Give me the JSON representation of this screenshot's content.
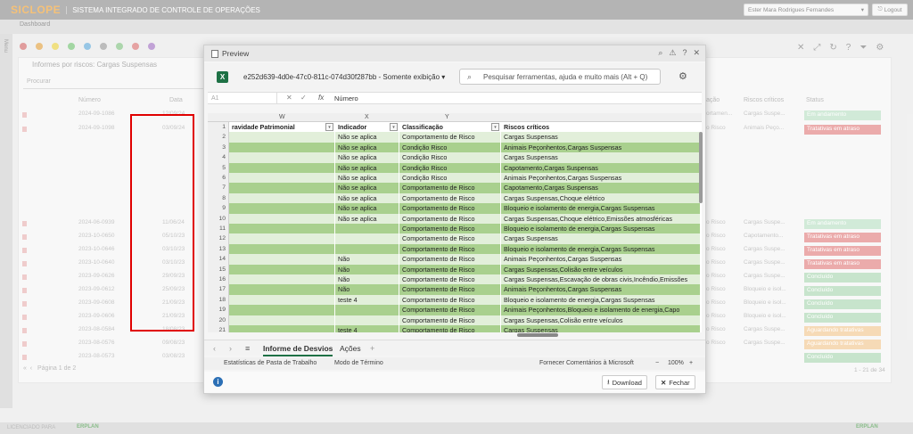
{
  "app": {
    "logo": "SICLOPE",
    "system_title": "SISTEMA INTEGRADO DE CONTROLE DE OPERAÇÕES",
    "user_name": "Ester Mara Rodrigues Fernandes",
    "logout_label": "Logout",
    "side_menu_label": "Menu",
    "dashboard_tab": "Dashboard"
  },
  "background": {
    "title": "Informes por riscos: Cargas Suspensas",
    "search_placeholder": "Procurar",
    "columns": {
      "numero": "Número",
      "data": "Data",
      "classificacao": "ação",
      "riscos": "Riscos críticos",
      "status": "Status"
    },
    "rows": [
      {
        "num": "2024-09-1086",
        "date": "12/09/24",
        "cls": "ortamen...",
        "risk": "Cargas Suspe...",
        "status": "Em andamento",
        "color": "#b9dfc4"
      },
      {
        "num": "2024-09-1098",
        "date": "03/09/24",
        "cls": "o Risco",
        "risk": "Animais Peço...",
        "status": "Tratativas em atraso",
        "color": "#e07f7f"
      },
      {
        "num": "2024-06-0939",
        "date": "11/06/24",
        "cls": "o Risco",
        "risk": "Cargas Suspe...",
        "status": "Em andamento",
        "color": "#b9dfc4"
      },
      {
        "num": "2023-10-0650",
        "date": "05/10/23",
        "cls": "o Risco",
        "risk": "Capotamento...",
        "status": "Tratativas em atraso",
        "color": "#e07f7f"
      },
      {
        "num": "2023-10-0646",
        "date": "03/10/23",
        "cls": "o Risco",
        "risk": "Cargas Suspe...",
        "status": "Tratativas em atraso",
        "color": "#e07f7f"
      },
      {
        "num": "2023-10-0640",
        "date": "03/10/23",
        "cls": "o Risco",
        "risk": "Cargas Suspe...",
        "status": "Tratativas em atraso",
        "color": "#e07f7f"
      },
      {
        "num": "2023-09-0626",
        "date": "29/09/23",
        "cls": "o Risco",
        "risk": "Cargas Suspe...",
        "status": "Concluído",
        "color": "#a9d6b1"
      },
      {
        "num": "2023-09-0612",
        "date": "25/09/23",
        "cls": "o Risco",
        "risk": "Bloqueio e isol...",
        "status": "Concluído",
        "color": "#a9d6b1"
      },
      {
        "num": "2023-09-0608",
        "date": "21/09/23",
        "cls": "o Risco",
        "risk": "Bloqueio e isol...",
        "status": "Concluído",
        "color": "#a9d6b1"
      },
      {
        "num": "2023-09-0606",
        "date": "21/09/23",
        "cls": "o Risco",
        "risk": "Bloqueio e isol...",
        "status": "Concluído",
        "color": "#a9d6b1"
      },
      {
        "num": "2023-08-0584",
        "date": "18/08/23",
        "cls": "o Risco",
        "risk": "Cargas Suspe...",
        "status": "Aguardando tratativas",
        "color": "#f2c690"
      },
      {
        "num": "2023-08-0576",
        "date": "09/08/23",
        "cls": "o Risco",
        "risk": "Cargas Suspe...",
        "status": "Aguardando tratativas",
        "color": "#f2c690"
      },
      {
        "num": "2023-08-0573",
        "date": "03/08/23",
        "cls": "",
        "risk": "",
        "status": "Concluído",
        "color": "#a9d6b1"
      }
    ],
    "pager": {
      "page_label": "Página",
      "page_value": "1",
      "of_label": "de 2"
    },
    "count_text": "1 - 21 de 34"
  },
  "preview": {
    "window_title": "Preview",
    "file_name": "e252d639-4d0e-47c0-811c-074d30f287bb",
    "mode": "Somente exibição",
    "search_placeholder": "Pesquisar ferramentas, ajuda e muito mais (Alt + Q)",
    "name_box": "A1",
    "formula_value": "Número",
    "columns": [
      "W",
      "X",
      "Y"
    ],
    "headers": [
      "ravidade Patrimonial",
      "Indicador",
      "Classificação",
      "Riscos críticos"
    ],
    "rows": [
      {
        "n": "2",
        "ind": "Não se aplica",
        "cls": "Comportamento de Risco",
        "risk": "Cargas Suspensas"
      },
      {
        "n": "3",
        "ind": "Não se aplica",
        "cls": "Condição Risco",
        "risk": "Animais Peçonhentos,Cargas Suspensas"
      },
      {
        "n": "4",
        "ind": "Não se aplica",
        "cls": "Condição Risco",
        "risk": "Cargas Suspensas"
      },
      {
        "n": "5",
        "ind": "Não se aplica",
        "cls": "Condição Risco",
        "risk": "Capotamento,Cargas Suspensas"
      },
      {
        "n": "6",
        "ind": "Não se aplica",
        "cls": "Condição Risco",
        "risk": "Animais Peçonhentos,Cargas Suspensas"
      },
      {
        "n": "7",
        "ind": "Não se aplica",
        "cls": "Comportamento de Risco",
        "risk": "Capotamento,Cargas Suspensas"
      },
      {
        "n": "8",
        "ind": "Não se aplica",
        "cls": "Comportamento de Risco",
        "risk": "Cargas Suspensas,Choque elétrico"
      },
      {
        "n": "9",
        "ind": "Não se aplica",
        "cls": "Comportamento de Risco",
        "risk": "Bloqueio e isolamento de energia,Cargas Suspensas"
      },
      {
        "n": "10",
        "ind": "Não se aplica",
        "cls": "Comportamento de Risco",
        "risk": "Cargas Suspensas,Choque elétrico,Emissões atmosféricas"
      },
      {
        "n": "11",
        "ind": "",
        "cls": "Comportamento de Risco",
        "risk": "Bloqueio e isolamento de energia,Cargas Suspensas"
      },
      {
        "n": "12",
        "ind": "",
        "cls": "Comportamento de Risco",
        "risk": "Cargas Suspensas"
      },
      {
        "n": "13",
        "ind": "",
        "cls": "Comportamento de Risco",
        "risk": "Bloqueio e isolamento de energia,Cargas Suspensas"
      },
      {
        "n": "14",
        "ind": "Não",
        "cls": "Comportamento de Risco",
        "risk": "Animais Peçonhentos,Cargas Suspensas"
      },
      {
        "n": "15",
        "ind": "Não",
        "cls": "Comportamento de Risco",
        "risk": "Cargas Suspensas,Colisão entre veículos"
      },
      {
        "n": "16",
        "ind": "Não",
        "cls": "Comportamento de Risco",
        "risk": "Cargas Suspensas,Escavação de obras civis,Incêndio,Emissões"
      },
      {
        "n": "17",
        "ind": "Não",
        "cls": "Comportamento de Risco",
        "risk": "Animais Peçonhentos,Cargas Suspensas"
      },
      {
        "n": "18",
        "ind": "teste 4",
        "cls": "Comportamento de Risco",
        "risk": "Bloqueio e isolamento de energia,Cargas Suspensas"
      },
      {
        "n": "19",
        "ind": "",
        "cls": "Comportamento de Risco",
        "risk": "Animais Peçonhentos,Bloqueio e isolamento de energia,Capo"
      },
      {
        "n": "20",
        "ind": "",
        "cls": "Comportamento de Risco",
        "risk": "Cargas Suspensas,Colisão entre veículos"
      },
      {
        "n": "21",
        "ind": "teste 4",
        "cls": "Comportamento de Risco",
        "risk": "Cargas Suspensas"
      }
    ],
    "sheet_tabs": [
      "Informe de Desvios",
      "Ações"
    ],
    "status": {
      "stats": "Estatísticas de Pasta de Trabalho",
      "mode": "Modo de Término",
      "feedback": "Fornecer Comentários à Microsoft",
      "zoom": "100%"
    },
    "download_label": "Download",
    "close_label": "Fechar"
  },
  "footer": {
    "left": "LICENCIADO PARA",
    "brand": "ERPLAN"
  }
}
